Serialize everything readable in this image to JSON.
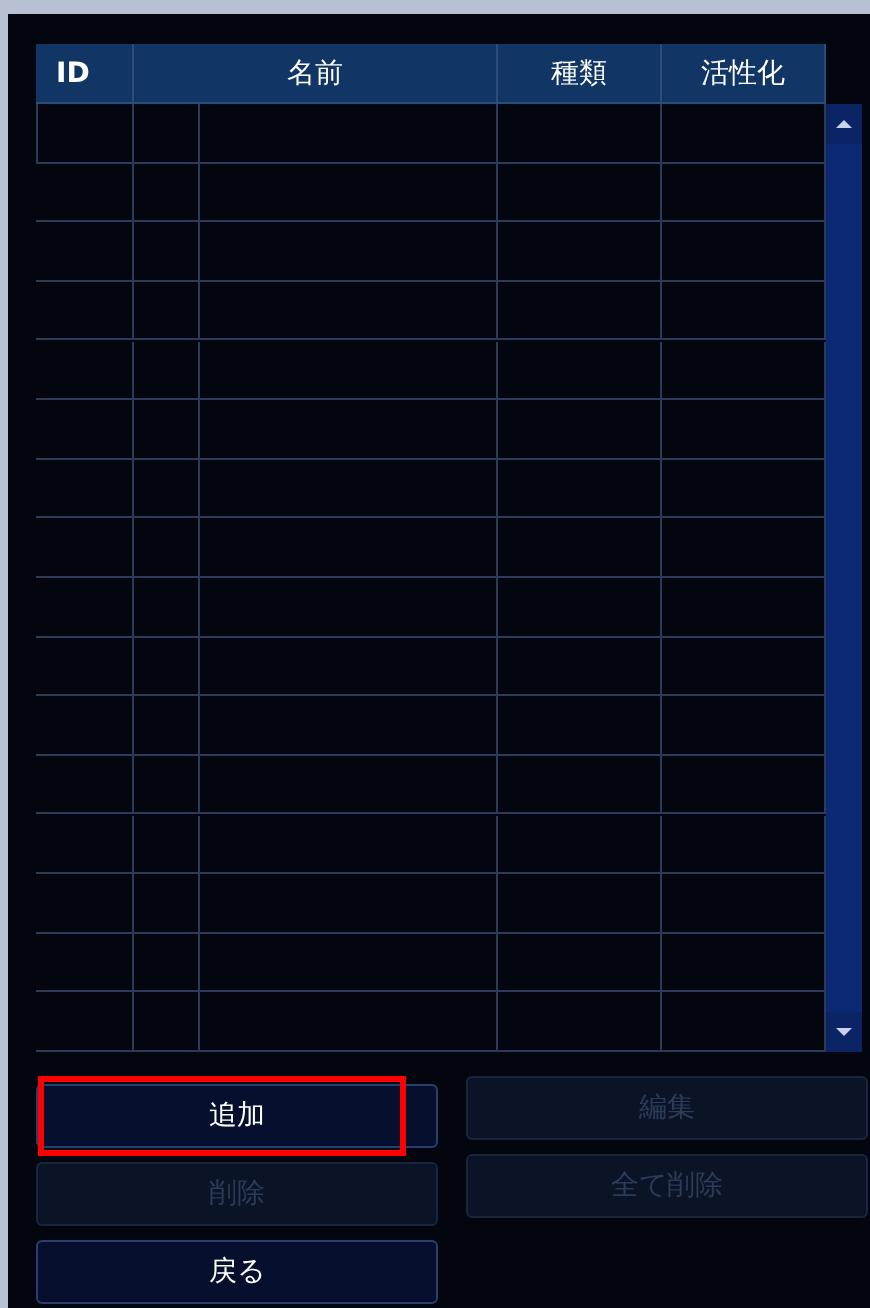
{
  "table": {
    "columns": [
      {
        "label": "ID"
      },
      {
        "label": "名前"
      },
      {
        "label": "種類"
      },
      {
        "label": "活性化"
      }
    ]
  },
  "buttons_left": [
    {
      "label": "追加",
      "disabled": false,
      "highlighted": true
    },
    {
      "label": "削除",
      "disabled": true,
      "highlighted": false
    },
    {
      "label": "戻る",
      "disabled": false,
      "highlighted": false
    }
  ],
  "buttons_right": [
    {
      "label": "編集",
      "disabled": true,
      "highlighted": false
    },
    {
      "label": "全て削除",
      "disabled": true,
      "highlighted": false
    }
  ]
}
